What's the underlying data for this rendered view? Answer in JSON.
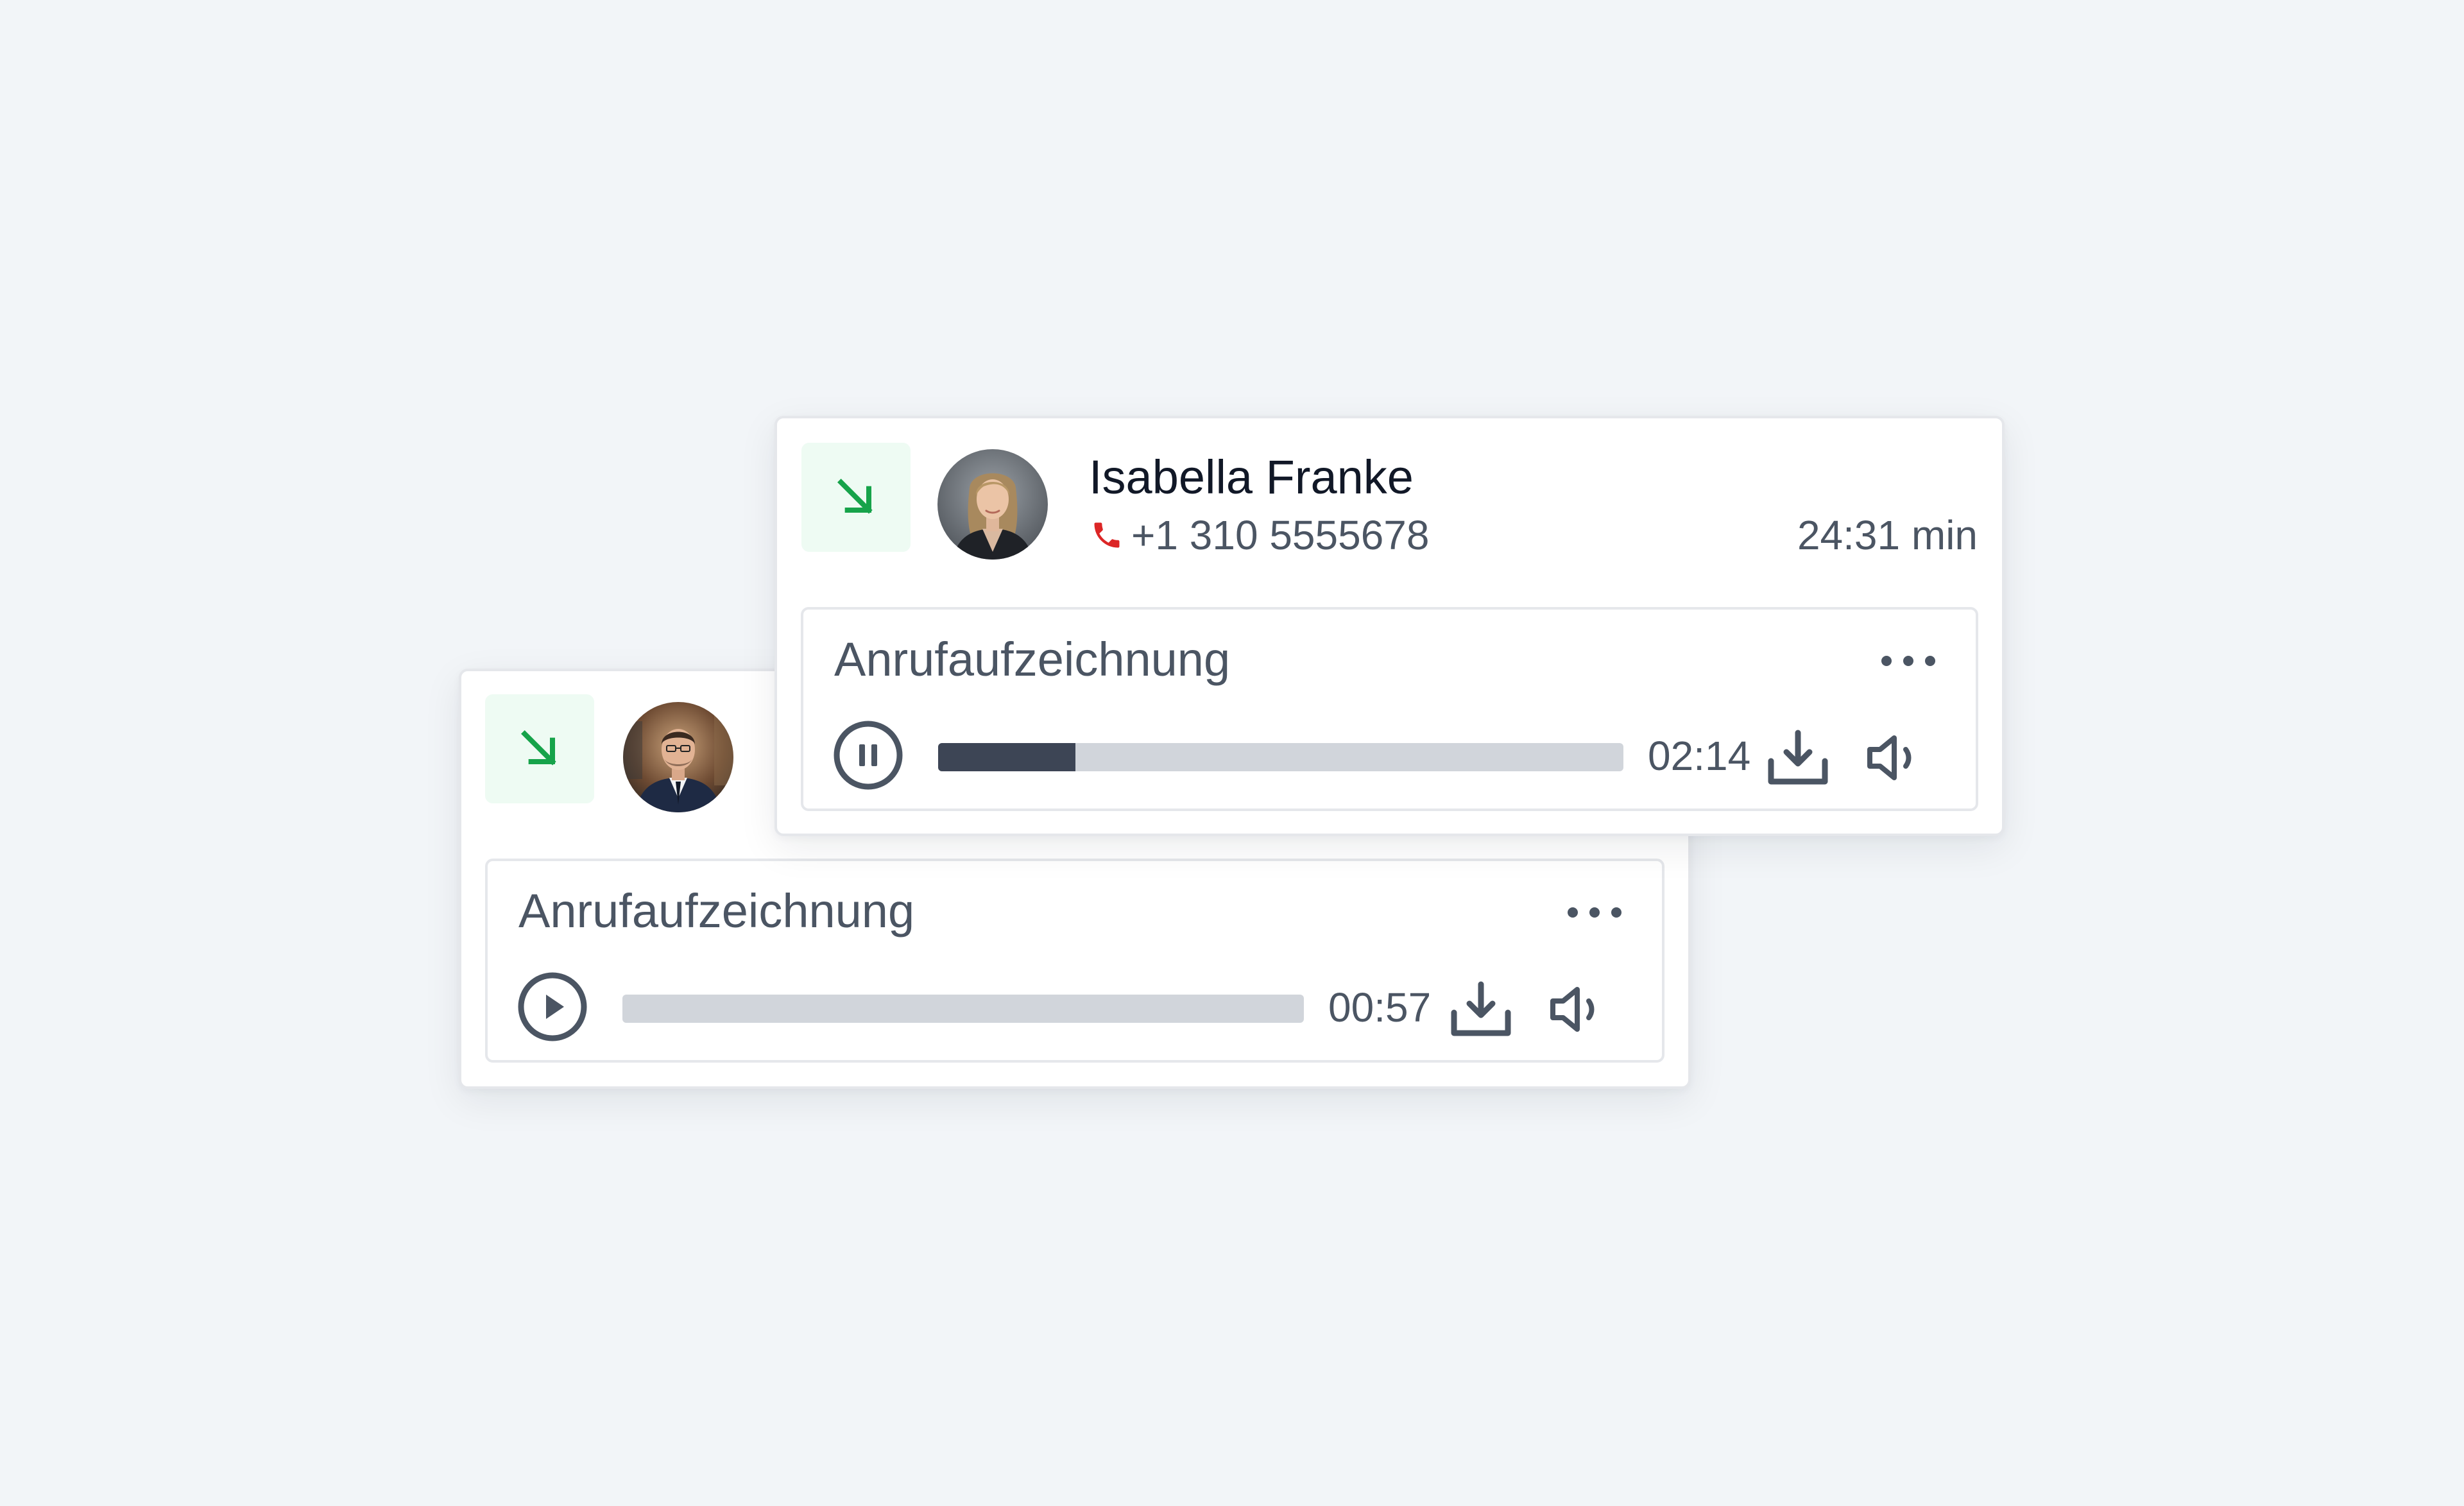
{
  "calls": [
    {
      "direction_icon": "arrow-down-right-icon",
      "avatar_icon": "avatar-man-icon",
      "recording": {
        "title": "Anrufaufzeichnung",
        "more_icon": "more-horizontal-icon",
        "control_icon": "play-icon",
        "progress": 0,
        "time": "00:57",
        "download_icon": "download-icon",
        "volume_icon": "volume-icon"
      }
    },
    {
      "direction_icon": "arrow-down-right-icon",
      "avatar_icon": "avatar-woman-icon",
      "name": "Isabella Franke",
      "phone_icon": "phone-icon",
      "phone": "+1 310 5555678",
      "duration": "24:31 min",
      "recording": {
        "title": "Anrufaufzeichnung",
        "more_icon": "more-horizontal-icon",
        "control_icon": "pause-icon",
        "progress": 0.2,
        "time": "02:14",
        "download_icon": "download-icon",
        "volume_icon": "volume-icon"
      }
    }
  ],
  "colors": {
    "background": "#f2f5f8",
    "incoming_green": "#16a34a",
    "incoming_bg": "#eefbf3",
    "phone_red": "#dc2626",
    "progress_fill": "#3d4555",
    "progress_track": "#d1d5db",
    "text_primary": "#111827",
    "text_secondary": "#4b5563"
  }
}
